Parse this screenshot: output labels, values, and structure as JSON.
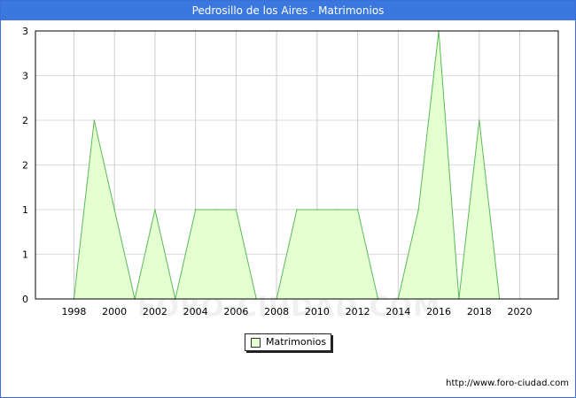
{
  "header": {
    "title": "Pedrosillo de los Aires - Matrimonios"
  },
  "legend": {
    "label": "Matrimonios",
    "color": "#e4ffd0"
  },
  "footer": {
    "credit": "http://www.foro-ciudad.com"
  },
  "watermark": "FORO-CIUDAD.COM",
  "chart_data": {
    "type": "area",
    "title": "Pedrosillo de los Aires - Matrimonios",
    "series": [
      {
        "name": "Matrimonios",
        "x": [
          1998,
          1999,
          2000,
          2001,
          2002,
          2003,
          2004,
          2005,
          2006,
          2007,
          2008,
          2009,
          2010,
          2011,
          2012,
          2013,
          2014,
          2015,
          2016,
          2017,
          2018,
          2019
        ],
        "values": [
          0,
          2,
          1,
          0,
          1,
          0,
          1,
          1,
          1,
          0,
          0,
          1,
          1,
          1,
          1,
          0,
          0,
          1,
          3,
          0,
          2,
          0
        ]
      }
    ],
    "xlim": [
      1996.1,
      2021.9
    ],
    "ylim": [
      0,
      3
    ],
    "x_ticks": [
      1998,
      2000,
      2002,
      2004,
      2006,
      2008,
      2010,
      2012,
      2014,
      2016,
      2018,
      2020
    ],
    "y_ticks": [
      0,
      1,
      1,
      2,
      2,
      3,
      3
    ],
    "grid": true,
    "legend_position": "bottom-center",
    "fill_color": "#e4ffd0",
    "line_color": "#5bb85b"
  }
}
